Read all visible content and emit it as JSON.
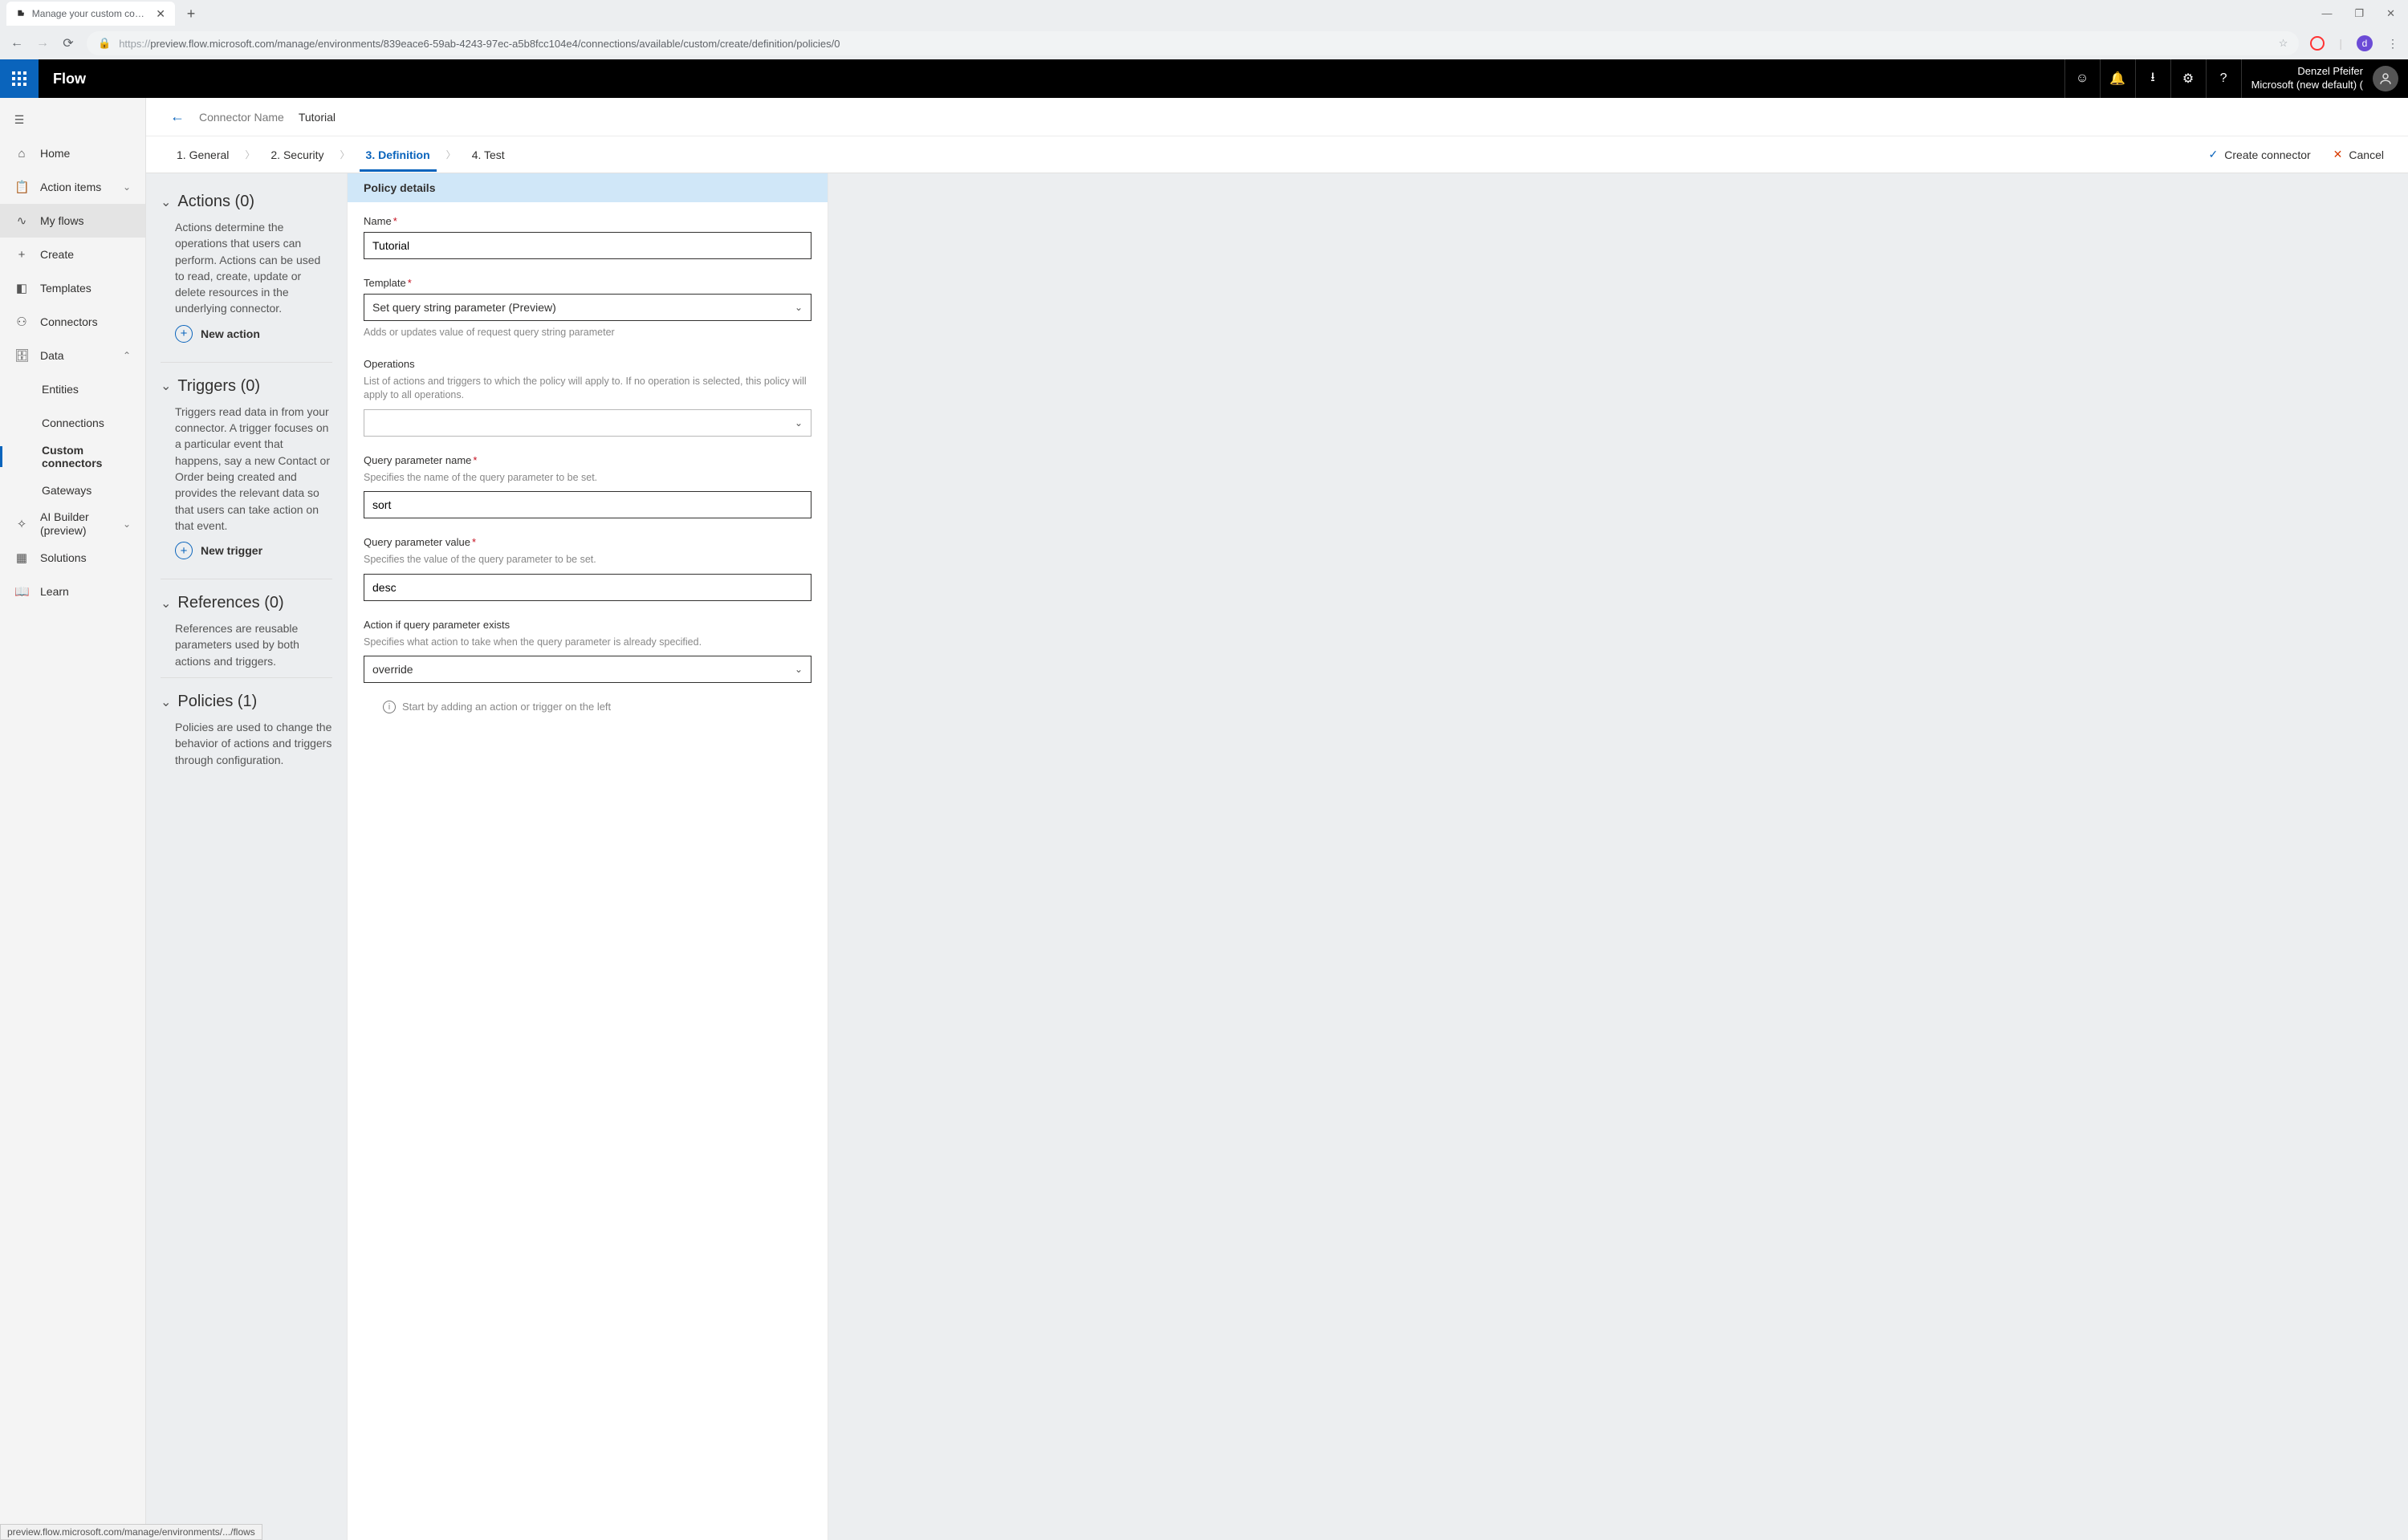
{
  "browser": {
    "tab_title": "Manage your custom connectors",
    "url_full": "https://preview.flow.microsoft.com/manage/environments/839eace6-59ab-4243-97ec-a5b8fcc104e4/connections/available/custom/create/definition/policies/0",
    "status": "preview.flow.microsoft.com/manage/environments/.../flows"
  },
  "appbar": {
    "appname": "Flow",
    "username": "Denzel Pfeifer",
    "env": "Microsoft (new default) ("
  },
  "sidebar": {
    "items": [
      {
        "label": "Home"
      },
      {
        "label": "Action items"
      },
      {
        "label": "My flows"
      },
      {
        "label": "Create"
      },
      {
        "label": "Templates"
      },
      {
        "label": "Connectors"
      },
      {
        "label": "Data"
      },
      {
        "label": "Entities"
      },
      {
        "label": "Connections"
      },
      {
        "label": "Custom connectors"
      },
      {
        "label": "Gateways"
      },
      {
        "label": "AI Builder (preview)"
      },
      {
        "label": "Solutions"
      },
      {
        "label": "Learn"
      }
    ]
  },
  "header": {
    "back_label": "Connector Name",
    "connector_name": "Tutorial",
    "steps": [
      "1. General",
      "2. Security",
      "3. Definition",
      "4. Test"
    ],
    "create": "Create connector",
    "cancel": "Cancel"
  },
  "sections": {
    "actions": {
      "title": "Actions (0)",
      "desc": "Actions determine the operations that users can perform. Actions can be used to read, create, update or delete resources in the underlying connector.",
      "add": "New action"
    },
    "triggers": {
      "title": "Triggers (0)",
      "desc": "Triggers read data in from your connector. A trigger focuses on a particular event that happens, say a new Contact or Order being created and provides the relevant data so that users can take action on that event.",
      "add": "New trigger"
    },
    "refs": {
      "title": "References (0)",
      "desc": "References are reusable parameters used by both actions and triggers."
    },
    "policies": {
      "title": "Policies (1)",
      "desc": "Policies are used to change the behavior of actions and triggers through configuration."
    }
  },
  "policy": {
    "header": "Policy details",
    "name_label": "Name",
    "name_value": "Tutorial",
    "template_label": "Template",
    "template_value": "Set query string parameter (Preview)",
    "template_help": "Adds or updates value of request query string parameter",
    "ops_label": "Operations",
    "ops_help": "List of actions and triggers to which the policy will apply to. If no operation is selected, this policy will apply to all operations.",
    "qpn_label": "Query parameter name",
    "qpn_help": "Specifies the name of the query parameter to be set.",
    "qpn_value": "sort",
    "qpv_label": "Query parameter value",
    "qpv_help": "Specifies the value of the query parameter to be set.",
    "qpv_value": "desc",
    "action_label": "Action if query parameter exists",
    "action_help": "Specifies what action to take when the query parameter is already specified.",
    "action_value": "override",
    "hint": "Start by adding an action or trigger on the left"
  }
}
